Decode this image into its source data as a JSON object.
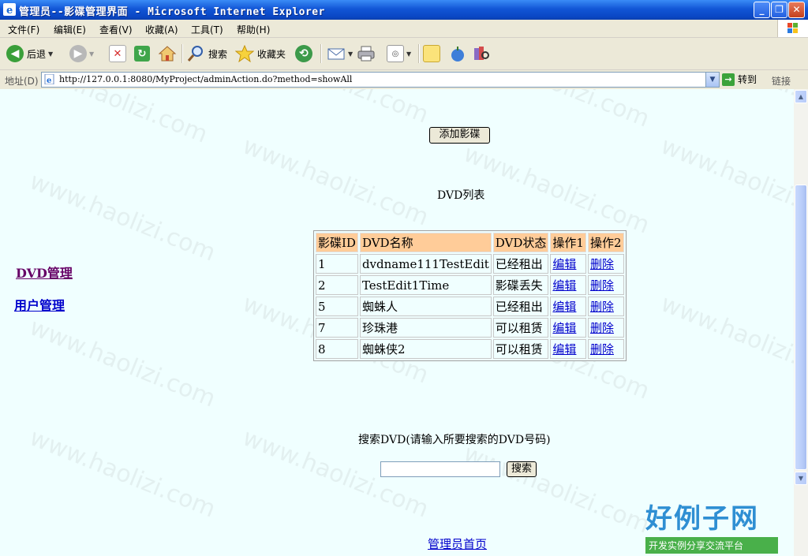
{
  "window": {
    "title": "管理员--影碟管理界面 - Microsoft Internet Explorer",
    "buttons": {
      "minimize": "_",
      "maximize": "❐",
      "close": "✕"
    }
  },
  "menu": [
    "文件(F)",
    "编辑(E)",
    "查看(V)",
    "收藏(A)",
    "工具(T)",
    "帮助(H)"
  ],
  "toolbar": {
    "back": "后退",
    "search": "搜索",
    "favorites": "收藏夹"
  },
  "address": {
    "label": "地址(D)",
    "url": "http://127.0.0.1:8080/MyProject/adminAction.do?method=showAll",
    "go": "转到",
    "links": "链接"
  },
  "sidebar": {
    "items": [
      "DVD管理",
      "用户管理"
    ]
  },
  "page": {
    "add_button": "添加影碟",
    "list_title": "DVD列表",
    "table": {
      "headers": [
        "影碟ID",
        "DVD名称",
        "DVD状态",
        "操作1",
        "操作2"
      ],
      "rows": [
        {
          "id": "1",
          "name": "dvdname111TestEdit",
          "status": "已经租出",
          "op1": "编辑",
          "op2": "删除"
        },
        {
          "id": "2",
          "name": "TestEdit1Time",
          "status": "影碟丢失",
          "op1": "编辑",
          "op2": "删除"
        },
        {
          "id": "5",
          "name": "蜘蛛人",
          "status": "已经租出",
          "op1": "编辑",
          "op2": "删除"
        },
        {
          "id": "7",
          "name": "珍珠港",
          "status": "可以租赁",
          "op1": "编辑",
          "op2": "删除"
        },
        {
          "id": "8",
          "name": "蜘蛛侠2",
          "status": "可以租赁",
          "op1": "编辑",
          "op2": "删除"
        }
      ]
    },
    "search_prompt": "搜索DVD(请输入所要搜索的DVD号码)",
    "search_button": "搜索",
    "search_value": "",
    "home_link": "管理员首页"
  },
  "watermark": "www.haolizi.com",
  "logo": {
    "main": "好例子网",
    "tagline": "开发实例分享交流平台"
  }
}
